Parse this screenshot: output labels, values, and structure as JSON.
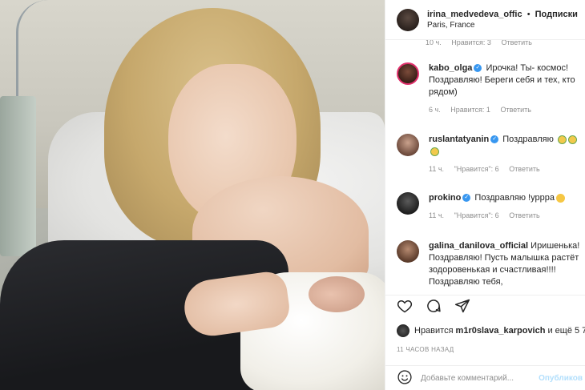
{
  "post_author": {
    "username": "irina_medvedeva_offic",
    "separator": "•",
    "follow_label": "Подписки",
    "location": "Paris, France"
  },
  "partial_row": {
    "time": "10 ч.",
    "likes": "Нравится: 3",
    "reply": "Ответить"
  },
  "comments": [
    {
      "user": "kabo_olga",
      "verified": true,
      "text": "Ирочка! Ты- космос! Поздравляю! Береги себя и тех, кто рядом)",
      "time": "6 ч.",
      "likes": "Нравится: 1",
      "reply": "Ответить"
    },
    {
      "user": "ruslantatyanin",
      "verified": true,
      "text": "Поздравляю",
      "time": "11 ч.",
      "likes": "\"Нравится\": 6",
      "reply": "Ответить"
    },
    {
      "user": "prokino",
      "verified": true,
      "text": "Поздравляю !уррра",
      "time": "11 ч.",
      "likes": "\"Нравится\": 6",
      "reply": "Ответить"
    },
    {
      "user": "galina_danilova_official",
      "verified": false,
      "text": "Иришенька! Поздравляю! Пусть малышка растёт зодоровенькая и счастливая!!!! Поздравляю тебя,"
    }
  ],
  "likes_line": {
    "prefix": "Нравится",
    "user": "m1r0slava_karpovich",
    "suffix": "и ещё 5 7"
  },
  "timestamp": "11 ЧАСОВ НАЗАД",
  "add_comment": {
    "placeholder": "Добавьте комментарий...",
    "publish": "Опубликов"
  },
  "icons": [
    "heart-icon",
    "comment-icon",
    "share-icon",
    "emoji-icon"
  ],
  "colors": {
    "verified": "#3897f0",
    "meta_gray": "#8e8e8e",
    "publish_disabled": "#b2dffc"
  }
}
